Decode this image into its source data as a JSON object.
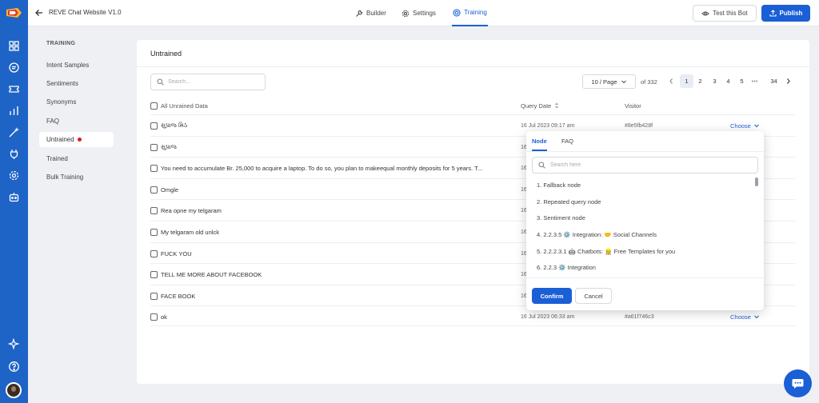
{
  "app": {
    "title": "REVE Chat Website V1.0"
  },
  "nav": {
    "tabs": [
      {
        "label": "Builder",
        "icon": "wrench-icon"
      },
      {
        "label": "Settings",
        "icon": "gear-icon"
      },
      {
        "label": "Training",
        "icon": "target-icon",
        "active": true
      }
    ]
  },
  "actions": {
    "test_label": "Test this Bot",
    "publish_label": "Publish"
  },
  "sidebar": {
    "heading": "TRAINING",
    "items": [
      {
        "label": "Intent Samples"
      },
      {
        "label": "Sentiments"
      },
      {
        "label": "Synonyms"
      },
      {
        "label": "FAQ"
      },
      {
        "label": "Untrained",
        "active": true,
        "badge": "red-dot"
      },
      {
        "label": "Trained"
      },
      {
        "label": "Bulk Training"
      }
    ]
  },
  "main": {
    "title": "Untrained",
    "search_placeholder": "Search...",
    "page_size": "10 / Page",
    "of_total": "of 332",
    "pages": [
      "1",
      "2",
      "3",
      "4",
      "5",
      "•••",
      "34"
    ],
    "current_page": "1",
    "columns": {
      "all": "All Unrained Data",
      "date": "Query Date",
      "visitor": "Visitor"
    },
    "rows": [
      {
        "text": "સુપ્રાજ મિઠ",
        "date": "16 Jul 2023 09:17 am",
        "visitor": "#8e5fb428f",
        "choose": "Choose"
      },
      {
        "text": "સુપ્રાજ",
        "date": "16"
      },
      {
        "text": "You need to accumulate Br. 25,000 to acquire a laptop. To do so, you plan to makeequal monthly deposits for 5 years. T...",
        "date": "16"
      },
      {
        "text": "Omgle",
        "date": "16"
      },
      {
        "text": "Rea opne my telgaram",
        "date": "16"
      },
      {
        "text": "My telgaram old unlck",
        "date": "16"
      },
      {
        "text": "FUCK YOU",
        "date": "16"
      },
      {
        "text": "TELL ME MORE ABOUT FACEBOOK",
        "date": "16"
      },
      {
        "text": "FACE BOOK",
        "date": "16"
      },
      {
        "text": "ok",
        "date": "16 Jul 2023 06:33 am",
        "visitor": "#a61f746c3",
        "choose": "Choose"
      }
    ]
  },
  "popup": {
    "tabs": [
      "Node",
      "FAQ"
    ],
    "search_placeholder": "Search here",
    "options": [
      "1. Fallback node",
      "2. Repeated query node",
      "3. Sentiment node",
      "4. 2.2.3.5 ⚙️ Integration: 🤝 Social Channels",
      "5. 2.2.2.3.1 🤖 Chatbots: 👷 Free Templates for you",
      "6. 2.2.3 ⚙️ Integration"
    ],
    "confirm_label": "Confirm",
    "cancel_label": "Cancel"
  },
  "colors": {
    "primary": "#1a5fd6",
    "rail": "#1e63c6",
    "badge": "#d61e1e"
  }
}
